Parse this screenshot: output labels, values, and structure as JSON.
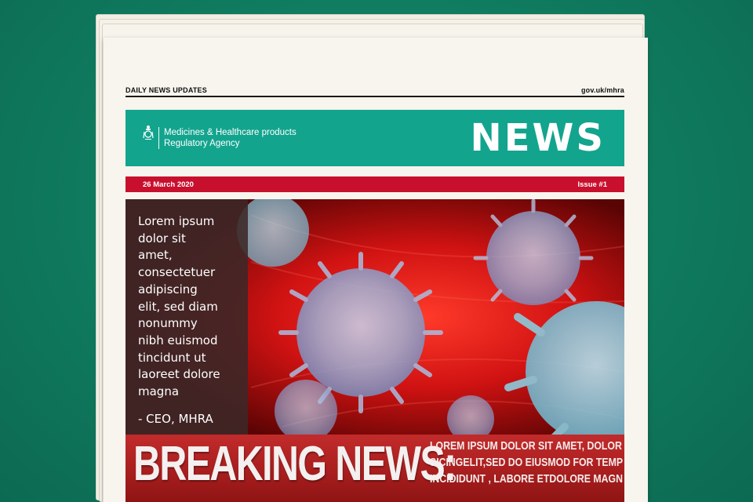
{
  "topline": {
    "left": "DAILY NEWS UPDATES",
    "right": "gov.uk/mhra"
  },
  "masthead": {
    "agency_line1": "Medicines & Healthcare products",
    "agency_line2": "Regulatory Agency",
    "title": "NEWS",
    "crest_icon": "royal-crest-icon",
    "background_color": "#13a48e"
  },
  "datebar": {
    "date": "26 March 2020",
    "issue": "Issue #1",
    "background_color": "#c8102e"
  },
  "hero": {
    "quote_lines": [
      "Lorem ipsum",
      "dolor sit",
      "amet,",
      "consectetuer",
      "adipiscing",
      "elit, sed diam",
      "nonummy",
      "nibh euismod",
      "tincidunt ut",
      "laoreet dolore",
      "magna"
    ],
    "quote_author": "- CEO, MHRA"
  },
  "breaking": {
    "title": "BREAKING NEWS:",
    "ticker_lines": [
      "LOREM IPSUM DOLOR SIT AMET, DOLOR CONUS",
      "SICINGELIT,SED DO EIUSMOD FOR TEMPO IN TO",
      "INCIDIDUNT , LABORE ETDOLORE MAGNA ADD"
    ]
  }
}
